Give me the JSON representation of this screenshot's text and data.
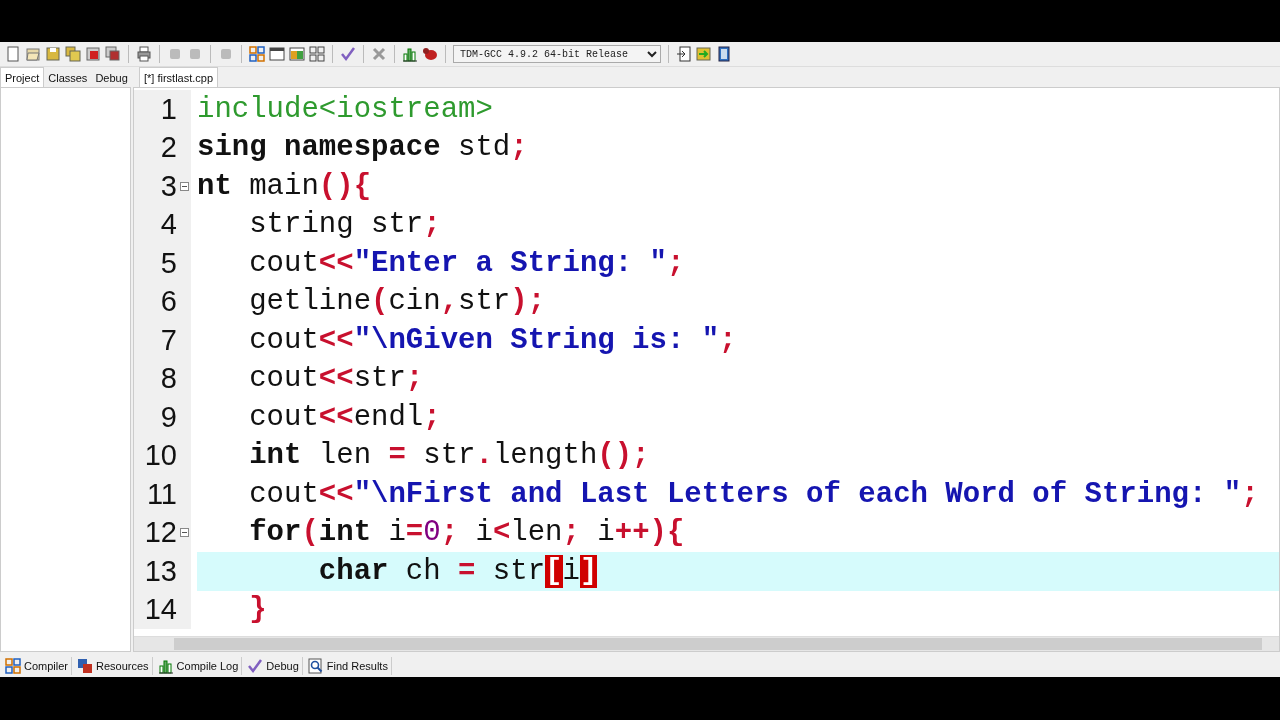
{
  "toolbar": {
    "compiler": "TDM-GCC 4.9.2 64-bit Release"
  },
  "sidebar": {
    "tabs": [
      {
        "label": "Project",
        "selected": true
      },
      {
        "label": "Classes",
        "selected": false
      },
      {
        "label": "Debug",
        "selected": false
      }
    ]
  },
  "editor": {
    "tabs": [
      {
        "label": "[*] firstlast.cpp",
        "selected": true
      }
    ],
    "lines": [
      {
        "number": "1",
        "fold": false,
        "current": false,
        "tokens": [
          {
            "kind": "pre",
            "text": "include<iostream>"
          }
        ]
      },
      {
        "number": "2",
        "fold": false,
        "current": false,
        "tokens": [
          {
            "kind": "kw",
            "text": "sing namespace"
          },
          {
            "kind": "id",
            "text": " std"
          },
          {
            "kind": "sym",
            "text": ";"
          }
        ]
      },
      {
        "number": "3",
        "fold": true,
        "current": false,
        "tokens": [
          {
            "kind": "kw",
            "text": "nt"
          },
          {
            "kind": "id",
            "text": " main"
          },
          {
            "kind": "sym",
            "text": "(){"
          }
        ]
      },
      {
        "number": "4",
        "fold": false,
        "current": false,
        "tokens": [
          {
            "kind": "id",
            "text": "   string str"
          },
          {
            "kind": "sym",
            "text": ";"
          }
        ]
      },
      {
        "number": "5",
        "fold": false,
        "current": false,
        "tokens": [
          {
            "kind": "id",
            "text": "   cout"
          },
          {
            "kind": "sym",
            "text": "<<"
          },
          {
            "kind": "str",
            "text": "\"Enter a String: \""
          },
          {
            "kind": "sym",
            "text": ";"
          }
        ]
      },
      {
        "number": "6",
        "fold": false,
        "current": false,
        "tokens": [
          {
            "kind": "id",
            "text": "   getline"
          },
          {
            "kind": "sym",
            "text": "("
          },
          {
            "kind": "id",
            "text": "cin"
          },
          {
            "kind": "sym",
            "text": ","
          },
          {
            "kind": "id",
            "text": "str"
          },
          {
            "kind": "sym",
            "text": ");"
          }
        ]
      },
      {
        "number": "7",
        "fold": false,
        "current": false,
        "tokens": [
          {
            "kind": "id",
            "text": "   cout"
          },
          {
            "kind": "sym",
            "text": "<<"
          },
          {
            "kind": "str",
            "text": "\"\\nGiven String is: \""
          },
          {
            "kind": "sym",
            "text": ";"
          }
        ]
      },
      {
        "number": "8",
        "fold": false,
        "current": false,
        "tokens": [
          {
            "kind": "id",
            "text": "   cout"
          },
          {
            "kind": "sym",
            "text": "<<"
          },
          {
            "kind": "id",
            "text": "str"
          },
          {
            "kind": "sym",
            "text": ";"
          }
        ]
      },
      {
        "number": "9",
        "fold": false,
        "current": false,
        "tokens": [
          {
            "kind": "id",
            "text": "   cout"
          },
          {
            "kind": "sym",
            "text": "<<"
          },
          {
            "kind": "id",
            "text": "endl"
          },
          {
            "kind": "sym",
            "text": ";"
          }
        ]
      },
      {
        "number": "10",
        "fold": false,
        "current": false,
        "tokens": [
          {
            "kind": "kw",
            "text": "   int"
          },
          {
            "kind": "id",
            "text": " len "
          },
          {
            "kind": "sym",
            "text": "="
          },
          {
            "kind": "id",
            "text": " str"
          },
          {
            "kind": "sym",
            "text": "."
          },
          {
            "kind": "id",
            "text": "length"
          },
          {
            "kind": "sym",
            "text": "();"
          }
        ]
      },
      {
        "number": "11",
        "fold": false,
        "current": false,
        "tokens": [
          {
            "kind": "id",
            "text": "   cout"
          },
          {
            "kind": "sym",
            "text": "<<"
          },
          {
            "kind": "str",
            "text": "\"\\nFirst and Last Letters of each Word of String: \""
          },
          {
            "kind": "sym",
            "text": ";"
          }
        ]
      },
      {
        "number": "12",
        "fold": true,
        "current": false,
        "tokens": [
          {
            "kind": "kw",
            "text": "   for"
          },
          {
            "kind": "sym",
            "text": "("
          },
          {
            "kind": "kw",
            "text": "int"
          },
          {
            "kind": "id",
            "text": " i"
          },
          {
            "kind": "sym",
            "text": "="
          },
          {
            "kind": "num",
            "text": "0"
          },
          {
            "kind": "sym",
            "text": ";"
          },
          {
            "kind": "id",
            "text": " i"
          },
          {
            "kind": "sym",
            "text": "<"
          },
          {
            "kind": "id",
            "text": "len"
          },
          {
            "kind": "sym",
            "text": ";"
          },
          {
            "kind": "id",
            "text": " i"
          },
          {
            "kind": "sym",
            "text": "++){"
          }
        ]
      },
      {
        "number": "13",
        "fold": false,
        "current": true,
        "tokens": [
          {
            "kind": "kw",
            "text": "       char"
          },
          {
            "kind": "id",
            "text": " ch "
          },
          {
            "kind": "sym",
            "text": "="
          },
          {
            "kind": "id",
            "text": " str"
          },
          {
            "kind": "match",
            "text": "["
          },
          {
            "kind": "id",
            "text": "i"
          },
          {
            "kind": "match",
            "text": "]"
          }
        ]
      },
      {
        "number": "14",
        "fold": false,
        "current": false,
        "tokens": [
          {
            "kind": "sym",
            "text": "   }"
          }
        ]
      }
    ]
  },
  "bottom_tabs": [
    {
      "label": "Compiler"
    },
    {
      "label": "Resources"
    },
    {
      "label": "Compile Log"
    },
    {
      "label": "Debug"
    },
    {
      "label": "Find Results"
    }
  ]
}
